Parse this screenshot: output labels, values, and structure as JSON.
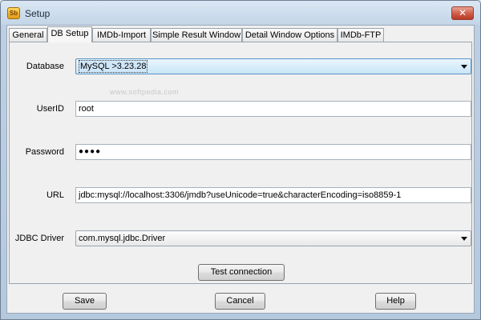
{
  "window": {
    "title": "Setup",
    "icon": "setup-app-icon",
    "close_glyph": "✕",
    "icon_text": "Sb"
  },
  "tabs": [
    {
      "label": "General"
    },
    {
      "label": "DB Setup",
      "active": true
    },
    {
      "label": "IMDb-Import"
    },
    {
      "label": "Simple Result Window"
    },
    {
      "label": "Detail Window Options"
    },
    {
      "label": "IMDb-FTP"
    }
  ],
  "db_setup": {
    "watermark": "www.softpedia.com",
    "database": {
      "label": "Database",
      "value": "MySQL >3.23.28"
    },
    "userid": {
      "label": "UserID",
      "value": "root"
    },
    "password": {
      "label": "Password",
      "value": "●●●●"
    },
    "url": {
      "label": "URL",
      "value": "jdbc:mysql://localhost:3306/jmdb?useUnicode=true&characterEncoding=iso8859-1"
    },
    "jdbc_driver": {
      "label": "JDBC Driver",
      "value": "com.mysql.jdbc.Driver"
    },
    "test_button": "Test connection"
  },
  "footer": {
    "save": "Save",
    "cancel": "Cancel",
    "help": "Help"
  },
  "colors": {
    "accent": "#5b93c4",
    "close": "#d05a45",
    "selection": "#cfe7f9"
  }
}
